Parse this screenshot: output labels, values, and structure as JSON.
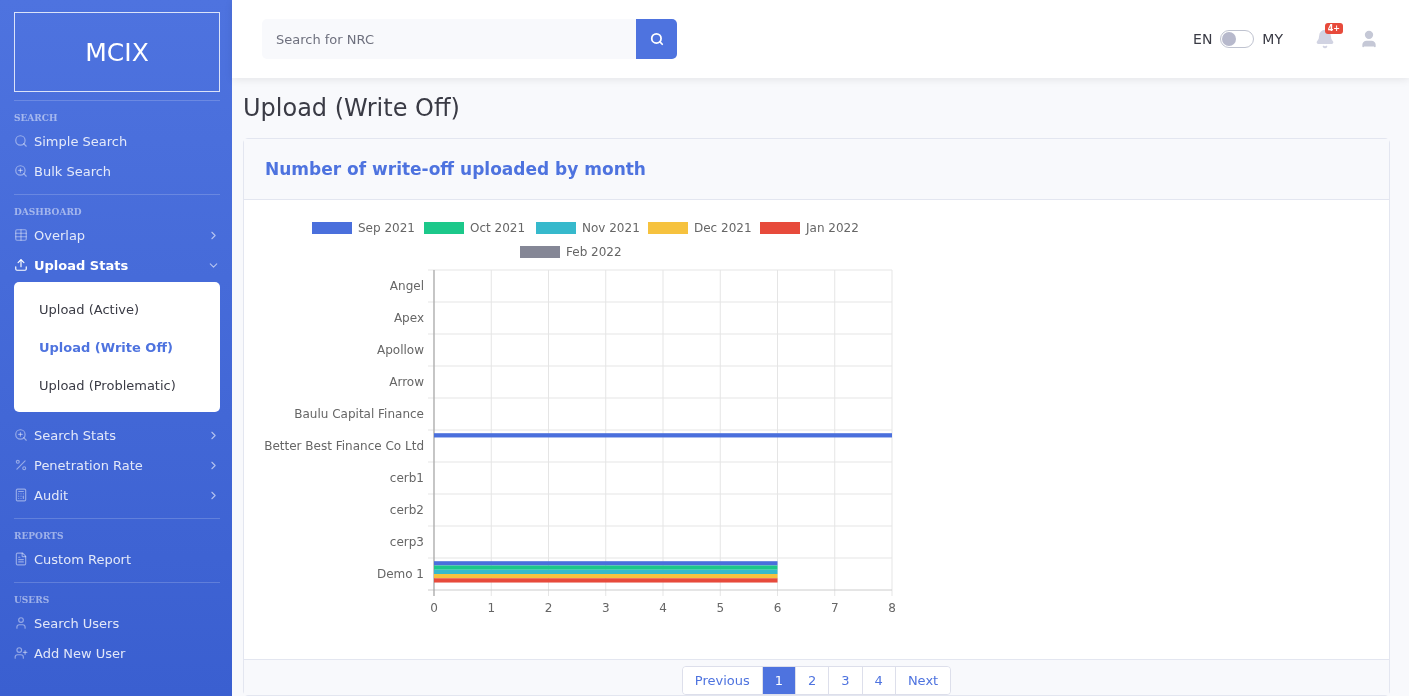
{
  "sidebar": {
    "brand": "MCIX",
    "sections": [
      {
        "heading": "SEARCH",
        "items": [
          {
            "label": "Simple Search"
          },
          {
            "label": "Bulk Search"
          }
        ]
      },
      {
        "heading": "DASHBOARD",
        "items": [
          {
            "label": "Overlap",
            "expanded": false
          },
          {
            "label": "Upload Stats",
            "expanded": true,
            "children": [
              {
                "label": "Upload (Active)",
                "selected": false
              },
              {
                "label": "Upload (Write Off)",
                "selected": true
              },
              {
                "label": "Upload (Problematic)",
                "selected": false
              }
            ]
          },
          {
            "label": "Search Stats",
            "expanded": false
          },
          {
            "label": "Penetration Rate",
            "expanded": false
          },
          {
            "label": "Audit",
            "expanded": false
          }
        ]
      },
      {
        "heading": "REPORTS",
        "items": [
          {
            "label": "Custom Report"
          }
        ]
      },
      {
        "heading": "USERS",
        "items": [
          {
            "label": "Search Users"
          },
          {
            "label": "Add New User"
          }
        ]
      }
    ]
  },
  "topbar": {
    "search": {
      "placeholder": "Search for NRC"
    },
    "language": {
      "left": "EN",
      "right": "MY",
      "on": false
    },
    "notifications": {
      "badge": "4+"
    }
  },
  "page_title": "Upload (Write Off)",
  "card": {
    "title": "Number of write-off uploaded by month",
    "chart_data": {
      "type": "bar",
      "orientation": "horizontal",
      "categories": [
        "Angel",
        "Apex",
        "Apollow",
        "Arrow",
        "Baulu Capital Finance",
        "Better Best Finance Co  Ltd",
        "cerb1",
        "cerb2",
        "cerp3",
        "Demo 1"
      ],
      "series": [
        {
          "name": "Sep 2021",
          "color": "#4a6fdc",
          "values": [
            0,
            0,
            0,
            0,
            0,
            8,
            0,
            0,
            0,
            6
          ]
        },
        {
          "name": "Oct 2021",
          "color": "#1cc88a",
          "values": [
            0,
            0,
            0,
            0,
            0,
            0,
            0,
            0,
            0,
            6
          ]
        },
        {
          "name": "Nov 2021",
          "color": "#36b9cc",
          "values": [
            0,
            0,
            0,
            0,
            0,
            0,
            0,
            0,
            0,
            6
          ]
        },
        {
          "name": "Dec 2021",
          "color": "#f6c23e",
          "values": [
            0,
            0,
            0,
            0,
            0,
            0,
            0,
            0,
            0,
            6
          ]
        },
        {
          "name": "Jan 2022",
          "color": "#e74a3b",
          "values": [
            0,
            0,
            0,
            0,
            0,
            0,
            0,
            0,
            0,
            6
          ]
        },
        {
          "name": "Feb 2022",
          "color": "#858796",
          "values": [
            0,
            0,
            0,
            0,
            0,
            0,
            0,
            0,
            0,
            0
          ]
        }
      ],
      "xlim": [
        0,
        8
      ],
      "xticks": [
        0,
        1,
        2,
        3,
        4,
        5,
        6,
        7,
        8
      ],
      "grid": true,
      "legend": "top"
    },
    "pagination": [
      {
        "label": "Previous",
        "selected": false
      },
      {
        "label": "1",
        "selected": true
      },
      {
        "label": "2",
        "selected": false
      },
      {
        "label": "3",
        "selected": false
      },
      {
        "label": "4",
        "selected": false
      },
      {
        "label": "Next",
        "selected": false
      }
    ]
  }
}
